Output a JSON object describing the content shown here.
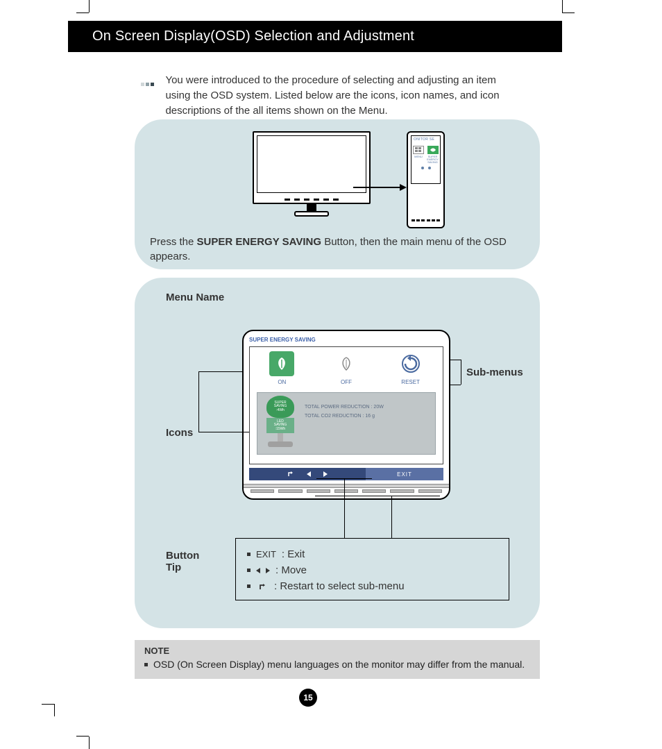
{
  "header": {
    "title": "On Screen Display(OSD) Selection and Adjustment"
  },
  "intro": "You were introduced to the procedure of selecting and adjusting an item using the OSD system. Listed below are the icons, icon names, and icon descriptions of the all items shown on the Menu.",
  "panel1": {
    "caption_pre": "Press the ",
    "caption_bold": "SUPER ENERGY SAVING",
    "caption_post": " Button, then the main menu of the OSD appears.",
    "zoom": {
      "heading": "ONITOR SE",
      "menu_label": "MENU",
      "ses_label_l1": "SUPER",
      "ses_label_l2": "ENERGY",
      "ses_label_l3": "SAVING"
    }
  },
  "panel2": {
    "menu_name_label": "Menu Name",
    "icons_label": "Icons",
    "submenus_label": "Sub-menus",
    "button_tip_label1": "Button",
    "button_tip_label2": "Tip",
    "osd": {
      "title": "SUPER ENERGY SAVING",
      "options": {
        "on": "ON",
        "off": "OFF",
        "reset": "RESET"
      },
      "tree": {
        "top_l1": "SUPER",
        "top_l2": "SAVING",
        "top_l3": ":4Wh",
        "mid_l1": "LED",
        "mid_l2": "SAVING",
        "mid_l3": ":15Wh"
      },
      "stat1": "TOTAL POWER REDUCTION : 20W",
      "stat2": "TOTAL CO2 REDUCTION : 16 g",
      "nav_exit": "EXIT"
    },
    "tips": {
      "exit_sym": "EXIT",
      "exit_desc": ": Exit",
      "move_desc": ": Move",
      "restart_desc": ": Restart to select sub-menu"
    }
  },
  "note": {
    "title": "NOTE",
    "body": "OSD (On Screen Display) menu languages on the monitor may differ from the manual."
  },
  "page_number": "15"
}
